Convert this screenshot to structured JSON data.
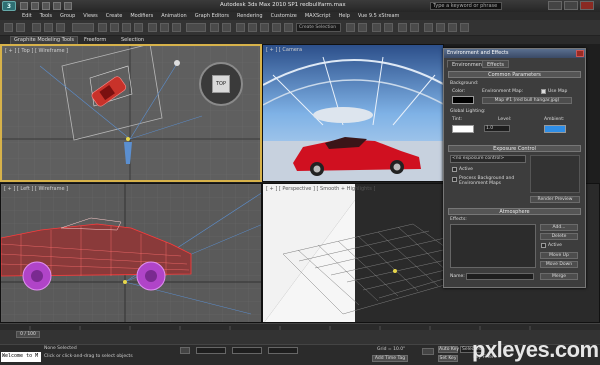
{
  "app": {
    "logo_text": "3",
    "title": "Autodesk 3ds Max 2010 SP1     redbullfarm.max",
    "search_placeholder": "Type a keyword or phrase"
  },
  "menu": [
    "Edit",
    "Tools",
    "Group",
    "Views",
    "Create",
    "Modifiers",
    "Animation",
    "Graph Editors",
    "Rendering",
    "Customize",
    "MAXScript",
    "Help",
    "Vue 9.5 xStream"
  ],
  "toolbar": {
    "selection_set": "Create Selection"
  },
  "ribbon": {
    "tabs": [
      "Graphite Modeling Tools",
      "Freeform",
      "Selection"
    ]
  },
  "viewports": {
    "top": "[ + ] [ Top ] [ Wireframe ]",
    "camera": "[ + ] [ Camera",
    "left": "[ + ] [ Left ] [ Wireframe ]",
    "perspective": "[ + ] [ Perspective ] [ Smooth + Highlights ]",
    "viewcube": "TOP"
  },
  "dialog": {
    "title": "Environment and Effects",
    "tabs": [
      "Environment",
      "Effects"
    ],
    "common": {
      "header": "Common Parameters",
      "background": "Background:",
      "color": "Color:",
      "env_map": "Environment Map:",
      "use_map": "Use Map",
      "map_name": "Map #1 (red bull hangar.jpg)",
      "global_lighting": "Global Lighting:",
      "tint": "Tint:",
      "level": "Level:",
      "level_value": "1.0",
      "ambient": "Ambient:"
    },
    "exposure": {
      "header": "Exposure Control",
      "dropdown": "<no exposure control>",
      "active": "Active",
      "process_bg": "Process Background and Environment Maps",
      "render_preview": "Render Preview"
    },
    "atmosphere": {
      "header": "Atmosphere",
      "effects": "Effects:",
      "add": "Add...",
      "delete": "Delete",
      "active": "Active",
      "move_up": "Move Up",
      "move_down": "Move Down",
      "name": "Name:",
      "merge": "Merge"
    }
  },
  "timeline": {
    "frame": "0 / 100"
  },
  "status": {
    "maxscript": "Welcome to M",
    "selection": "None Selected",
    "prompt": "Click or click-and-drag to select objects",
    "grid": "Grid = 10.0\"",
    "add_time_tag": "Add Time Tag",
    "auto_key": "Auto Key",
    "set_key": "Set Key",
    "key_filters": "Key Filters...",
    "selected": "Selected"
  },
  "watermark": "pxleyes.com",
  "colors": {
    "active_border": "#d7b24a",
    "ambient_swatch": "#2f8ee6",
    "car_red": "#d01020"
  }
}
